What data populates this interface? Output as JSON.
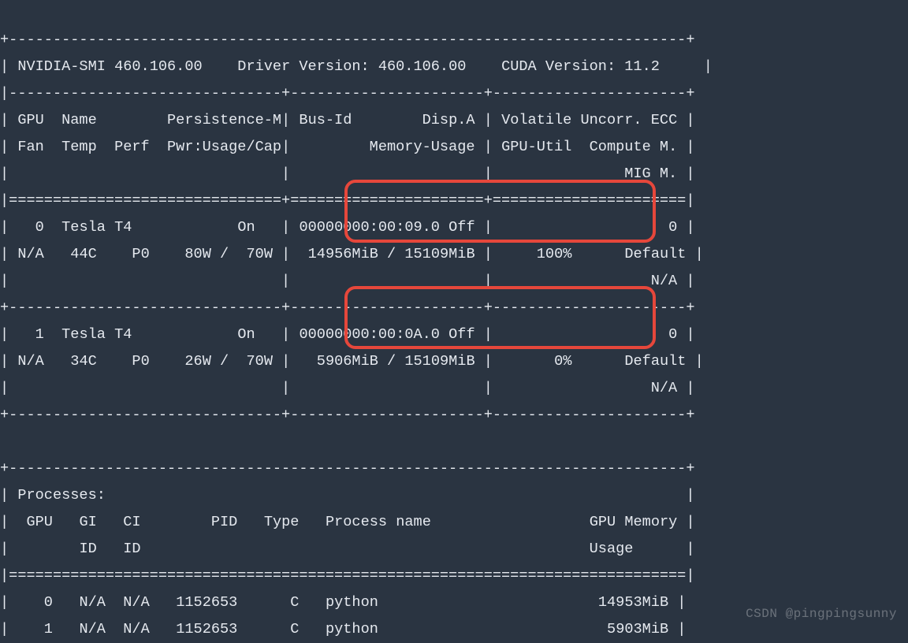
{
  "driver_header": {
    "smi": "NVIDIA-SMI 460.106.00",
    "driver": "Driver Version: 460.106.00",
    "cuda": "CUDA Version: 11.2"
  },
  "gpu_header": {
    "row1_left": "GPU  Name        Persistence-M",
    "row1_mid": "Bus-Id        Disp.A",
    "row1_right": "Volatile Uncorr. ECC",
    "row2_left": "Fan  Temp  Perf  Pwr:Usage/Cap",
    "row2_mid": "Memory-Usage",
    "row2_right": "GPU-Util  Compute M.",
    "row3_right": "MIG M."
  },
  "gpus": [
    {
      "idx": "0",
      "name": "Tesla T4",
      "persist": "On",
      "bus_id": "00000000:00:09.0",
      "disp": "Off",
      "ecc": "0",
      "fan": "N/A",
      "temp": "44C",
      "perf": "P0",
      "pwr": "80W /  70W",
      "mem": "14956MiB / 15109MiB",
      "util": "100%",
      "compute": "Default",
      "mig": "N/A"
    },
    {
      "idx": "1",
      "name": "Tesla T4",
      "persist": "On",
      "bus_id": "00000000:00:0A.0",
      "disp": "Off",
      "ecc": "0",
      "fan": "N/A",
      "temp": "34C",
      "perf": "P0",
      "pwr": "26W /  70W",
      "mem": "5906MiB / 15109MiB",
      "util": "0%",
      "compute": "Default",
      "mig": "N/A"
    }
  ],
  "proc_header": {
    "title": "Processes:",
    "row1": {
      "gpu": "GPU",
      "gi": "GI",
      "ci": "CI",
      "pid": "PID",
      "type": "Type",
      "pname": "Process name",
      "mem": "GPU Memory"
    },
    "row2": {
      "id1": "ID",
      "id2": "ID",
      "usage": "Usage"
    }
  },
  "processes": [
    {
      "gpu": "0",
      "gi": "N/A",
      "ci": "N/A",
      "pid": "1152653",
      "type": "C",
      "name": "python",
      "mem": "14953MiB"
    },
    {
      "gpu": "1",
      "gi": "N/A",
      "ci": "N/A",
      "pid": "1152653",
      "type": "C",
      "name": "python",
      "mem": "5903MiB"
    }
  ],
  "watermark": "CSDN @pingpingsunny"
}
